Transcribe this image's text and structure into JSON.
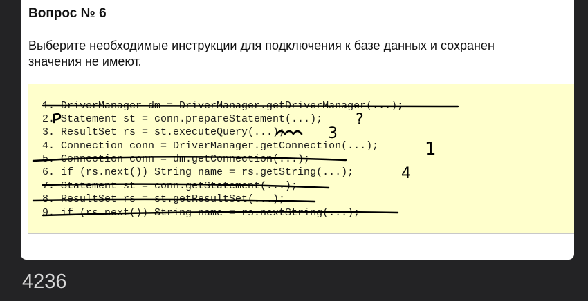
{
  "question": {
    "title": "Вопрос № 6",
    "text_line1": "Выберите необходимые инструкции для подключения к базе данных и сохранен",
    "text_line2": "значения не имеют."
  },
  "code_lines": [
    "1. DriverManager dm = DriverManager.getDriverManager(...);",
    "2. Statement st = conn.prepareStatement(...);",
    "3. ResultSet rs = st.executeQuery(...);",
    "4. Connection conn = DriverManager.getConnection(...);",
    "5. Connection conn = dm.getConnection(...);",
    "6. if (rs.next()) String name = rs.getString(...);",
    "7. Statement st = conn.getStatement(...);",
    "8. ResultSet rs = st.getResultSet(...);",
    "9. if (rs.next()) String name = rs.nextString(...);"
  ],
  "annotations": {
    "line2_mark": "?",
    "line3_mark": "3",
    "line4_mark": "1",
    "line6_mark": "4"
  },
  "footer": {
    "number": "4236"
  }
}
